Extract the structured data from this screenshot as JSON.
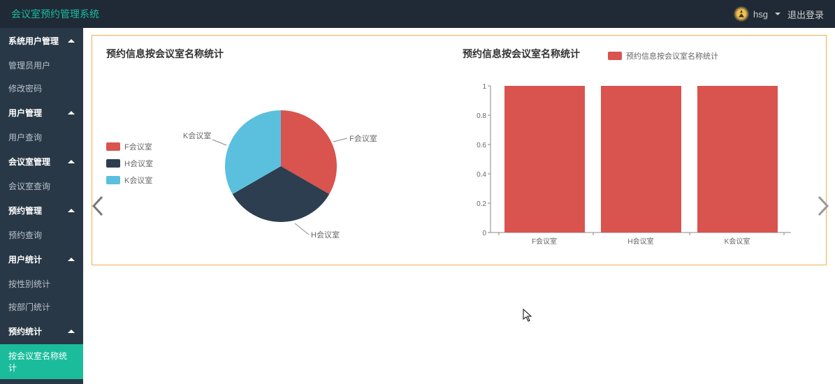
{
  "header": {
    "brand": "会议室预约管理系统",
    "username": "hsg",
    "logout": "退出登录"
  },
  "sidebar": {
    "groups": [
      {
        "label": "系统用户管理",
        "items": [
          "管理员用户",
          "修改密码"
        ]
      },
      {
        "label": "用户管理",
        "items": [
          "用户查询"
        ]
      },
      {
        "label": "会议室管理",
        "items": [
          "会议室查询"
        ]
      },
      {
        "label": "预约管理",
        "items": [
          "预约查询"
        ]
      },
      {
        "label": "用户统计",
        "items": [
          "按性别统计",
          "按部门统计"
        ]
      },
      {
        "label": "预约统计",
        "items": [
          "按会议室名称统计"
        ]
      }
    ],
    "active": "按会议室名称统计"
  },
  "charts": {
    "pie": {
      "title": "预约信息按会议室名称统计",
      "legend": [
        "F会议室",
        "H会议室",
        "K会议室"
      ],
      "labels": {
        "f": "F会议室",
        "h": "H会议室",
        "k": "K会议室"
      },
      "colors": {
        "f": "#d9534f",
        "h": "#2c3e50",
        "k": "#5bc0de"
      }
    },
    "bar": {
      "title": "预约信息按会议室名称统计",
      "legend_label": "预约信息按会议室名称统计",
      "legend_color": "#d9534f",
      "yticks": [
        "0",
        "0.2",
        "0.4",
        "0.6",
        "0.8",
        "1"
      ]
    }
  },
  "chart_data": [
    {
      "type": "pie",
      "title": "预约信息按会议室名称统计",
      "series": [
        {
          "name": "F会议室",
          "value": 1,
          "color": "#d9534f"
        },
        {
          "name": "H会议室",
          "value": 1,
          "color": "#2c3e50"
        },
        {
          "name": "K会议室",
          "value": 1,
          "color": "#5bc0de"
        }
      ]
    },
    {
      "type": "bar",
      "title": "预约信息按会议室名称统计",
      "categories": [
        "F会议室",
        "H会议室",
        "K会议室"
      ],
      "values": [
        1,
        1,
        1
      ],
      "ylim": [
        0,
        1
      ],
      "color": "#d9534f"
    }
  ]
}
